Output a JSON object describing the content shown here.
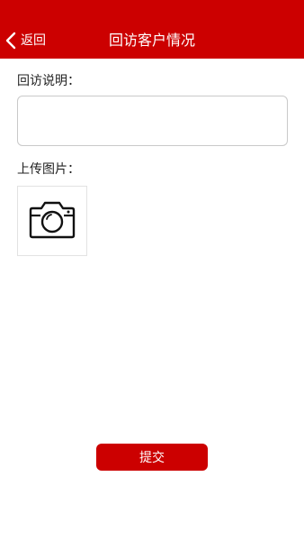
{
  "header": {
    "back_label": "返回",
    "title": "回访客户情况"
  },
  "form": {
    "description_label": "回访说明：",
    "description_value": "",
    "description_placeholder": "",
    "upload_label": "上传图片："
  },
  "actions": {
    "submit_label": "提交"
  },
  "icons": {
    "back": "chevron-left-icon",
    "upload": "camera-icon"
  },
  "colors": {
    "brand": "#cc0000",
    "text": "#222222",
    "border": "#c9c9c9"
  }
}
